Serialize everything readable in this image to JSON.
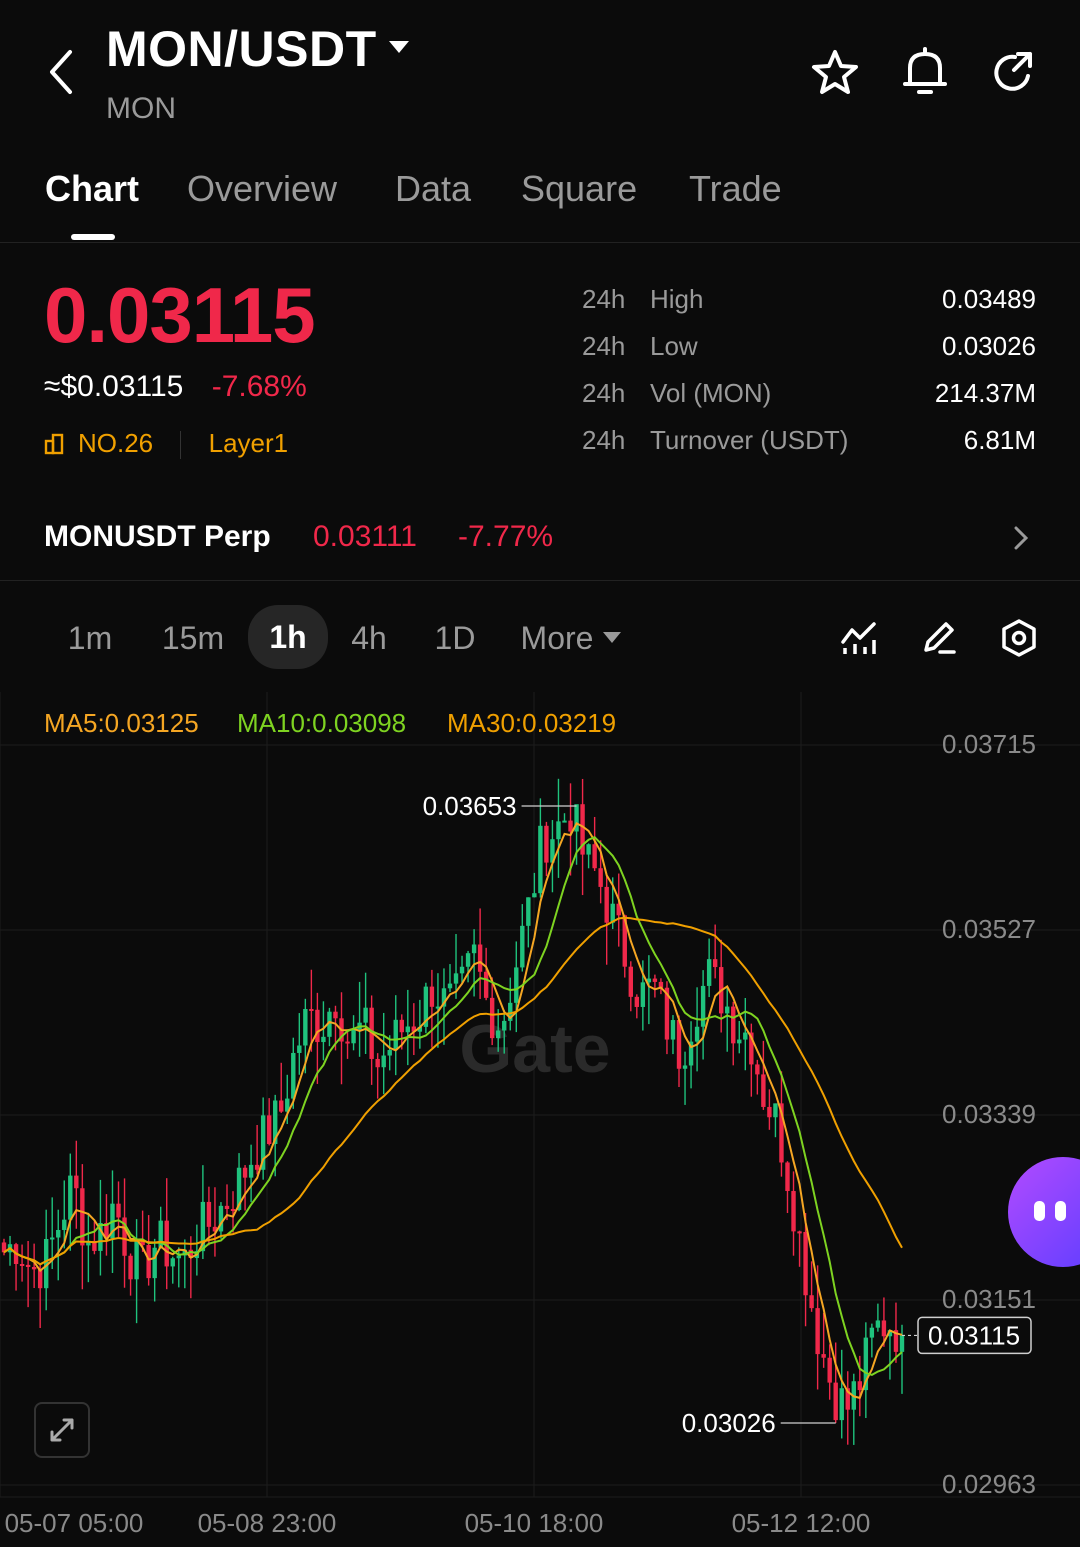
{
  "header": {
    "pair": "MON/USDT",
    "base": "MON",
    "icons": [
      "back-icon",
      "star-icon",
      "bell-icon",
      "share-refresh-icon"
    ]
  },
  "tabs": [
    {
      "label": "Chart",
      "active": true
    },
    {
      "label": "Overview",
      "active": false
    },
    {
      "label": "Data",
      "active": false
    },
    {
      "label": "Square",
      "active": false
    },
    {
      "label": "Trade",
      "active": false
    }
  ],
  "ticker": {
    "price": "0.03115",
    "usd": "≈$0.03115",
    "change": "-7.68%",
    "rank": "NO.26",
    "tag": "Layer1"
  },
  "stats": [
    {
      "period": "24h",
      "label": "High",
      "value": "0.03489"
    },
    {
      "period": "24h",
      "label": "Low",
      "value": "0.03026"
    },
    {
      "period": "24h",
      "label": "Vol (MON)",
      "value": "214.37M"
    },
    {
      "period": "24h",
      "label": "Turnover (USDT)",
      "value": "6.81M"
    }
  ],
  "perp": {
    "name": "MONUSDT Perp",
    "price": "0.03111",
    "change": "-7.77%"
  },
  "timeframes": [
    {
      "label": "1m",
      "active": false
    },
    {
      "label": "15m",
      "active": false
    },
    {
      "label": "1h",
      "active": true
    },
    {
      "label": "4h",
      "active": false
    },
    {
      "label": "1D",
      "active": false
    },
    {
      "label": "More",
      "active": false
    }
  ],
  "colors": {
    "up": "#1fc27d",
    "down": "#f0284a",
    "ma5": "#f5a623",
    "ma10": "#7ed321",
    "ma30": "#f0a000",
    "accent_purple": "#7b4dff"
  },
  "chart": {
    "ma5": "MA5:0.03125",
    "ma10": "MA10:0.03098",
    "ma30": "MA30:0.03219",
    "y_ticks": [
      "0.03715",
      "0.03527",
      "0.03339",
      "0.03151",
      "0.02963"
    ],
    "x_ticks": [
      "05-07 05:00",
      "05-08 23:00",
      "05-10 18:00",
      "05-12 12:00"
    ],
    "high_label": "0.03653",
    "low_label": "0.03026",
    "last_label": "0.03115",
    "watermark": "Gate"
  },
  "chart_data": {
    "type": "candlestick",
    "interval": "1h",
    "ylim": [
      0.02963,
      0.03715
    ],
    "y_ticks": [
      0.03715,
      0.03527,
      0.03339,
      0.03151,
      0.02963
    ],
    "x_ticks": [
      "05-07 05:00",
      "05-08 23:00",
      "05-10 18:00",
      "05-12 12:00"
    ],
    "high": 0.03653,
    "low": 0.03026,
    "last": 0.03115,
    "series": [
      {
        "name": "MA5",
        "last": 0.03125
      },
      {
        "name": "MA10",
        "last": 0.03098
      },
      {
        "name": "MA30",
        "last": 0.03219
      }
    ],
    "close_path": [
      0.032,
      0.0321,
      0.0318,
      0.0319,
      0.0323,
      0.0327,
      0.0321,
      0.0322,
      0.0325,
      0.032,
      0.0318,
      0.0321,
      0.032,
      0.0319,
      0.0322,
      0.0323,
      0.0325,
      0.0327,
      0.033,
      0.0332,
      0.0334,
      0.034,
      0.0344,
      0.0343,
      0.0346,
      0.0341,
      0.0343,
      0.0339,
      0.0341,
      0.0343,
      0.0344,
      0.0347,
      0.0345,
      0.0346,
      0.035,
      0.0345,
      0.0343,
      0.0349,
      0.0355,
      0.0362,
      0.0363,
      0.0365,
      0.036,
      0.0358,
      0.0354,
      0.035,
      0.0346,
      0.0347,
      0.0343,
      0.034,
      0.0345,
      0.0348,
      0.0346,
      0.0343,
      0.0342,
      0.0336,
      0.0333,
      0.0326,
      0.0318,
      0.0311,
      0.0306,
      0.0304,
      0.0307,
      0.0312,
      0.0313,
      0.03115
    ]
  }
}
